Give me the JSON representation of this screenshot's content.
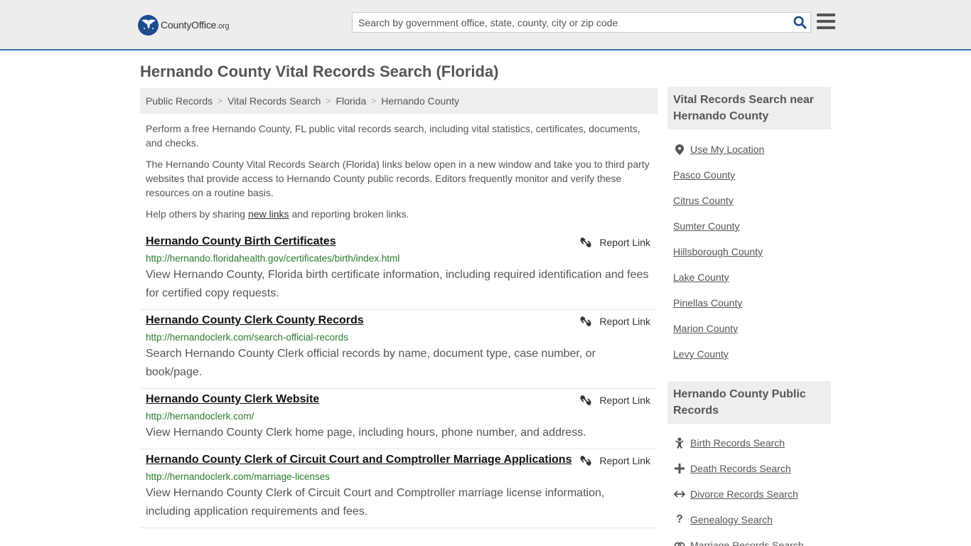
{
  "header": {
    "logo_brand": "CountyOffice",
    "logo_tld": ".org",
    "search_placeholder": "Search by government office, state, county, city or zip code"
  },
  "page": {
    "title": "Hernando County Vital Records Search (Florida)"
  },
  "breadcrumb": [
    {
      "label": "Public Records"
    },
    {
      "label": "Vital Records Search"
    },
    {
      "label": "Florida"
    },
    {
      "label": "Hernando County"
    }
  ],
  "intro": {
    "p1": "Perform a free Hernando County, FL public vital records search, including vital statistics, certificates, documents, and checks.",
    "p2": "The Hernando County Vital Records Search (Florida) links below open in a new window and take you to third party websites that provide access to Hernando County public records. Editors frequently monitor and verify these resources on a routine basis.",
    "p3_before": "Help others by sharing ",
    "p3_link": "new links",
    "p3_after": " and reporting broken links."
  },
  "report_label": "Report Link",
  "results": [
    {
      "title": "Hernando County Birth Certificates",
      "url": "http://hernando.floridahealth.gov/certificates/birth/index.html",
      "description": "View Hernando County, Florida birth certificate information, including required identification and fees for certified copy requests."
    },
    {
      "title": "Hernando County Clerk County Records",
      "url": "http://hernandoclerk.com/search-official-records",
      "description": "Search Hernando County Clerk official records by name, document type, case number, or book/page."
    },
    {
      "title": "Hernando County Clerk Website",
      "url": "http://hernandoclerk.com/",
      "description": "View Hernando County Clerk home page, including hours, phone number, and address."
    },
    {
      "title": "Hernando County Clerk of Circuit Court and Comptroller Marriage Applications",
      "url": "http://hernandoclerk.com/marriage-licenses",
      "description": "View Hernando County Clerk of Circuit Court and Comptroller marriage license information, including application requirements and fees."
    }
  ],
  "sidebar": {
    "nearby_title": "Vital Records Search near Hernando County",
    "use_location": "Use My Location",
    "nearby": [
      "Pasco County",
      "Citrus County",
      "Sumter County",
      "Hillsborough County",
      "Lake County",
      "Pinellas County",
      "Marion County",
      "Levy County"
    ],
    "public_title": "Hernando County Public Records",
    "public_records": [
      {
        "label": "Birth Records Search",
        "icon": "baby-icon"
      },
      {
        "label": "Death Records Search",
        "icon": "cross-icon"
      },
      {
        "label": "Divorce Records Search",
        "icon": "split-arrows-icon"
      },
      {
        "label": "Genealogy Search",
        "icon": "question-mark-icon"
      },
      {
        "label": "Marriage Records Search",
        "icon": "rings-icon"
      }
    ]
  },
  "colors": {
    "accent": "#3d70b2",
    "url_green": "#2a7a2a",
    "panel_gray": "#eeeeee"
  }
}
